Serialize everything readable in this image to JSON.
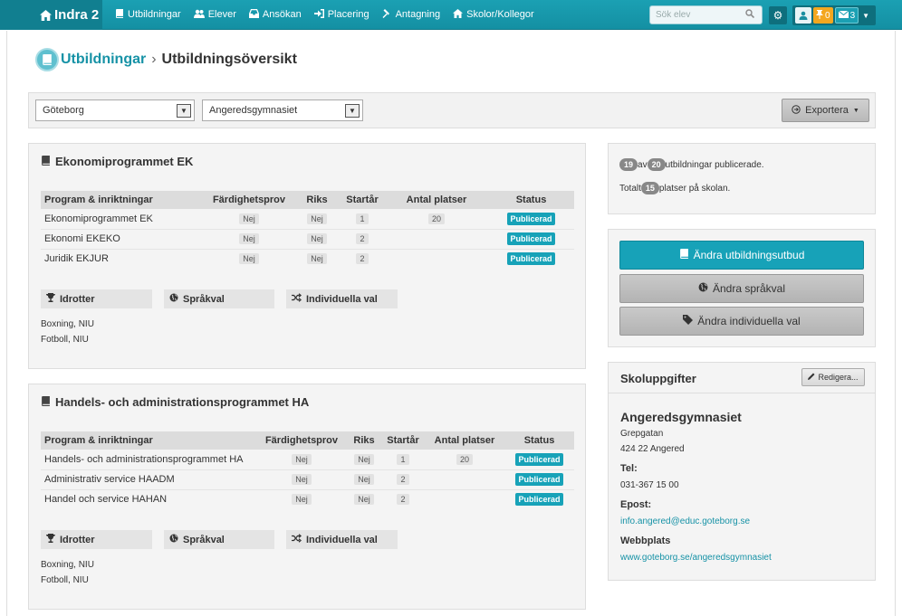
{
  "nav": {
    "brand": "Indra 2",
    "items": [
      {
        "label": "Utbildningar",
        "icon": "book-icon"
      },
      {
        "label": "Elever",
        "icon": "users-icon"
      },
      {
        "label": "Ansökan",
        "icon": "inbox-icon"
      },
      {
        "label": "Placering",
        "icon": "sign-in-icon"
      },
      {
        "label": "Antagning",
        "icon": "gavel-icon"
      },
      {
        "label": "Skolor/Kollegor",
        "icon": "home-icon"
      }
    ],
    "search_placeholder": "Sök elev",
    "notifications_count": "0",
    "messages_count": "3"
  },
  "breadcrumb": {
    "section": "Utbildningar",
    "separator": "›",
    "page": "Utbildningsöversikt"
  },
  "filters": {
    "city": "Göteborg",
    "school": "Angeredsgymnasiet",
    "export_label": "Exportera"
  },
  "table_headers": {
    "program": "Program & inriktningar",
    "skill_test": "Färdighetsprov",
    "national": "Riks",
    "start_year": "Startår",
    "places": "Antal platser",
    "status": "Status"
  },
  "programs": [
    {
      "title": "Ekonomiprogrammet EK",
      "rows": [
        {
          "name": "Ekonomiprogrammet EK",
          "skill_test": "Nej",
          "national": "Nej",
          "start_year": "1",
          "places": "20",
          "status": "Publicerad"
        },
        {
          "name": "Ekonomi EKEKO",
          "skill_test": "Nej",
          "national": "Nej",
          "start_year": "2",
          "places": "",
          "status": "Publicerad"
        },
        {
          "name": "Juridik EKJUR",
          "skill_test": "Nej",
          "national": "Nej",
          "start_year": "2",
          "places": "",
          "status": "Publicerad"
        }
      ],
      "sports_label": "Idrotter",
      "languages_label": "Språkval",
      "electives_label": "Individuella val",
      "sports": [
        "Boxning, NIU",
        "Fotboll, NIU"
      ]
    },
    {
      "title": "Handels- och administrationsprogrammet HA",
      "rows": [
        {
          "name": "Handels- och administrationsprogrammet HA",
          "skill_test": "Nej",
          "national": "Nej",
          "start_year": "1",
          "places": "20",
          "status": "Publicerad"
        },
        {
          "name": "Administrativ service HAADM",
          "skill_test": "Nej",
          "national": "Nej",
          "start_year": "2",
          "places": "",
          "status": "Publicerad"
        },
        {
          "name": "Handel och service HAHAN",
          "skill_test": "Nej",
          "national": "Nej",
          "start_year": "2",
          "places": "",
          "status": "Publicerad"
        }
      ],
      "sports_label": "Idrotter",
      "languages_label": "Språkval",
      "electives_label": "Individuella val",
      "sports": [
        "Boxning, NIU",
        "Fotboll, NIU"
      ]
    }
  ],
  "summary": {
    "published": "19",
    "of_word": "av",
    "total": "20",
    "published_suffix": "utbildningar publicerade.",
    "places_prefix": "Totalt",
    "places": "15",
    "places_suffix": "platser på skolan."
  },
  "actions": {
    "change_offering": "Ändra utbildningsutbud",
    "change_languages": "Ändra språkval",
    "change_electives": "Ändra individuella val"
  },
  "school_info": {
    "title": "Skoluppgifter",
    "edit_label": "Redigera...",
    "name": "Angeredsgymnasiet",
    "street": "Grepgatan",
    "postal": "424 22 Angered",
    "phone_label": "Tel:",
    "phone": "031-367 15 00",
    "email_label": "Epost:",
    "email": "info.angered@educ.goteborg.se",
    "web_label": "Webbplats",
    "web": "www.goteborg.se/angeredsgymnasiet"
  },
  "colors": {
    "brand": "#1ba0b3",
    "accent": "#17a2b8",
    "warning": "#f4a71f"
  }
}
